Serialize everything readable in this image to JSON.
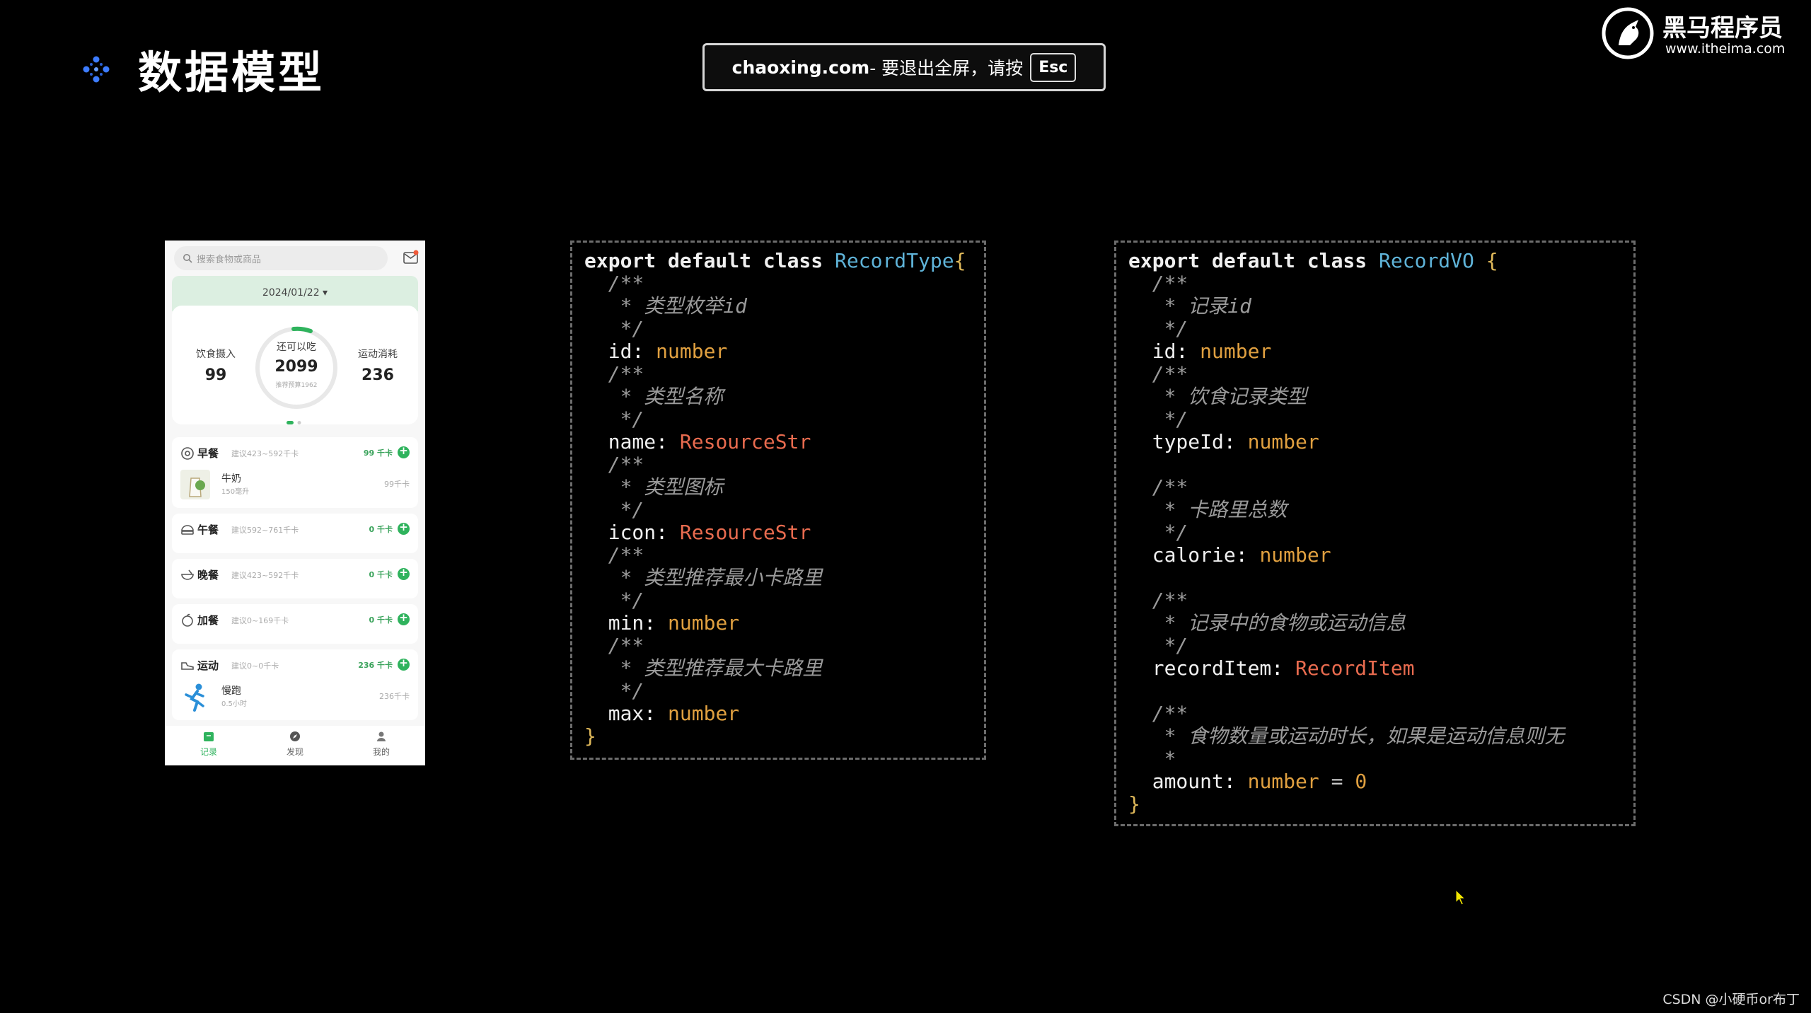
{
  "slide": {
    "title": "数据模型"
  },
  "banner": {
    "domain": "chaoxing.com",
    "text": " - 要退出全屏，请按",
    "key": "Esc"
  },
  "logo": {
    "name": "黑马程序员",
    "url": "www.itheima.com"
  },
  "phone": {
    "search_placeholder": "搜索食物或商品",
    "date": "2024/01/22 ▾",
    "intake": {
      "label": "饮食摄入",
      "value": "99"
    },
    "remaining": {
      "label": "还可以吃",
      "value": "2099",
      "sub": "推荐预算1962"
    },
    "burned": {
      "label": "运动消耗",
      "value": "236"
    },
    "meals": [
      {
        "name": "早餐",
        "hint": "建议423~592千卡",
        "kcal": "99 千卡",
        "item": {
          "name": "牛奶",
          "amount": "150毫升",
          "kcal": "99千卡"
        }
      },
      {
        "name": "午餐",
        "hint": "建议592~761千卡",
        "kcal": "0 千卡"
      },
      {
        "name": "晚餐",
        "hint": "建议423~592千卡",
        "kcal": "0 千卡"
      },
      {
        "name": "加餐",
        "hint": "建议0~169千卡",
        "kcal": "0 千卡"
      },
      {
        "name": "运动",
        "hint": "建议0~0千卡",
        "kcal": "236 千卡",
        "item": {
          "name": "慢跑",
          "amount": "0.5小时",
          "kcal": "236千卡"
        }
      }
    ],
    "tabs": [
      "记录",
      "发现",
      "我的"
    ],
    "accent": "#2fb35d"
  },
  "code_recordtype": {
    "header_kw": "export default class ",
    "class_name": "RecordType",
    "open_brace": "{",
    "close_brace": "}",
    "fields": [
      {
        "comment": "类型枚举id",
        "name": "id",
        "type": "number"
      },
      {
        "comment": "类型名称",
        "name": "name",
        "type": "ResourceStr"
      },
      {
        "comment": "类型图标",
        "name": "icon",
        "type": "ResourceStr"
      },
      {
        "comment": "类型推荐最小卡路里",
        "name": "min",
        "type": "number"
      },
      {
        "comment": "类型推荐最大卡路里",
        "name": "max",
        "type": "number"
      }
    ]
  },
  "code_recordvo": {
    "header_kw": "export default class ",
    "class_name": "RecordVO",
    "open_brace": " {",
    "close_brace": "}",
    "fields": [
      {
        "comment": "记录id",
        "name": "id",
        "type": "number"
      },
      {
        "comment": "饮食记录类型",
        "name": "typeId",
        "type": "number"
      },
      {
        "comment": "卡路里总数",
        "name": "calorie",
        "type": "number"
      },
      {
        "comment": "记录中的食物或运动信息",
        "name": "recordItem",
        "type": "RecordItem"
      },
      {
        "comment": "食物数量或运动时长，如果是运动信息则无",
        "name": "amount",
        "type": "number",
        "default": "0"
      }
    ]
  },
  "watermark": "CSDN @小硬币or布丁"
}
